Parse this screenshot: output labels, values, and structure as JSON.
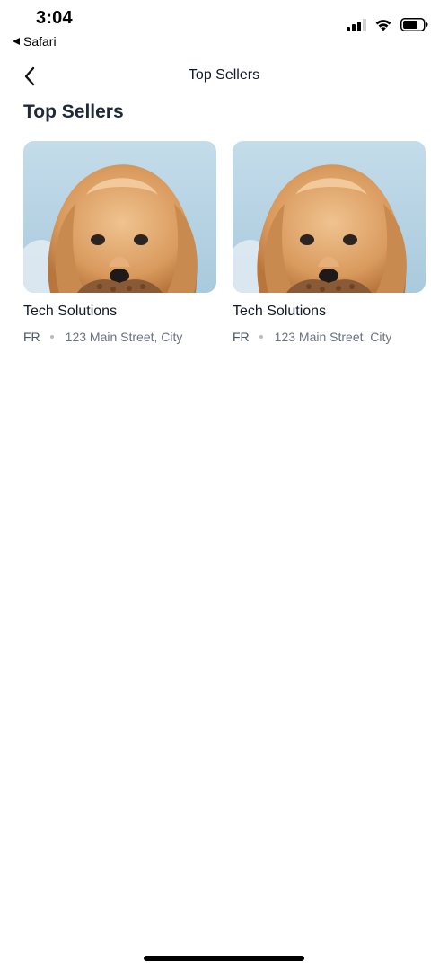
{
  "status_bar": {
    "time": "3:04",
    "back_app": "Safari",
    "icons": [
      "cellular-signal-icon",
      "wifi-icon",
      "battery-icon"
    ]
  },
  "nav": {
    "back_icon": "chevron-left-icon",
    "title": "Top Sellers"
  },
  "page": {
    "heading": "Top Sellers"
  },
  "sellers": [
    {
      "name": "Tech Solutions",
      "country": "FR",
      "address": "123 Main Street, City",
      "image": "dog-photo"
    },
    {
      "name": "Tech Solutions",
      "country": "FR",
      "address": "123 Main Street, City",
      "image": "dog-photo"
    }
  ],
  "colors": {
    "background": "#ffffff",
    "primary_text": "#111827",
    "secondary_text": "#6b7280",
    "photo_backdrop": "#bcd7e6"
  }
}
